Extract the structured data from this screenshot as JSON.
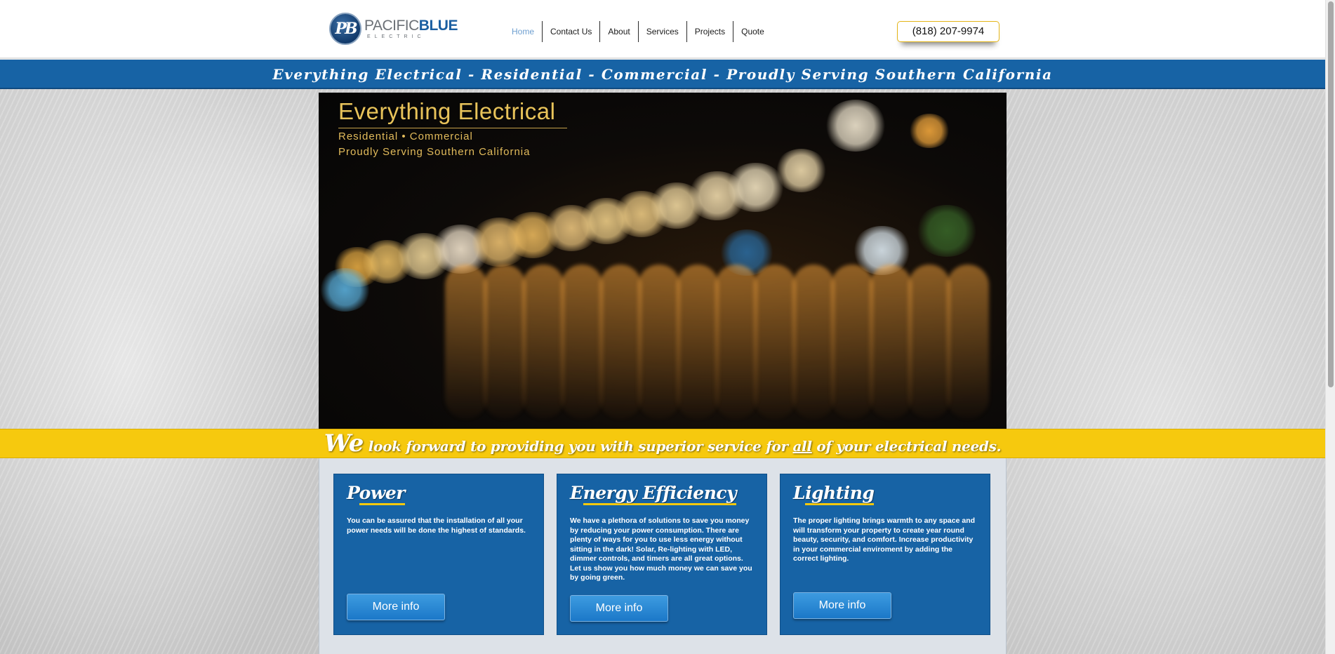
{
  "logo": {
    "badge": "PB",
    "name_left": "PACIFIC",
    "name_right": "BLUE",
    "sub": "ELECTRIC"
  },
  "nav": {
    "items": [
      {
        "label": "Home",
        "active": true
      },
      {
        "label": "Contact Us",
        "active": false
      },
      {
        "label": "About",
        "active": false
      },
      {
        "label": "Services",
        "active": false
      },
      {
        "label": "Projects",
        "active": false
      },
      {
        "label": "Quote",
        "active": false
      }
    ]
  },
  "phone": "(818) 207-9974",
  "tagline": "Everything Electrical - Residential - Commercial - Proudly Serving Southern California",
  "hero": {
    "title": "Everything Electrical",
    "line1": "Residential • Commercial",
    "line2": "Proudly Serving Southern California"
  },
  "banner": {
    "big": "We",
    "part1": " look forward to providing you with superior service for ",
    "underlined": "all",
    "part2": " of your electrical needs."
  },
  "cards": [
    {
      "title_first": "P",
      "title_rest": "ower",
      "body": "You can be assured that the installation of all your power needs will be done the highest of standards.",
      "button": "More info"
    },
    {
      "title_first": "E",
      "title_rest": "nergy Efficiency",
      "body": "We have a plethora of solutions to save you money by reducing your power consumption.  There are plenty of ways for you to use less energy without sitting in the dark!  Solar, Re-lighting with LED, dimmer controls, and timers are all great options.  Let us show you how much money we can save you by going green.",
      "button": "More info"
    },
    {
      "title_first": "L",
      "title_rest": "ighting",
      "body": "The proper lighting brings warmth to any space and will transform your property to create year round beauty, security, and comfort.  Increase productivity in your commercial enviroment by adding the correct lighting.",
      "button": "More info"
    }
  ],
  "colors": {
    "brand_blue": "#1763a5",
    "accent_yellow": "#f6c90e",
    "nav_active": "#6e9fd0"
  }
}
